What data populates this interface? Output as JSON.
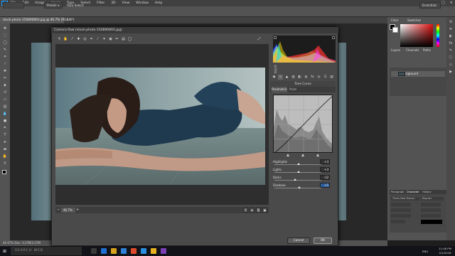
{
  "app": {
    "logo": "Ps"
  },
  "menu": [
    "File",
    "Edit",
    "Image",
    "Layer",
    "Type",
    "Select",
    "Filter",
    "3D",
    "View",
    "Window",
    "Help"
  ],
  "options": {
    "opt1": "Preset: ▾",
    "opt2": "Auto-Select:",
    "workspace": "Essentials"
  },
  "document": {
    "tab": "stock-photo-150890893.jpg @ 46.7% (RGB/8*)",
    "status": "46.67%   Doc: 3.27M/3.27M"
  },
  "dialog": {
    "title": "Camera Raw (stock-photo-150890893.jpg)",
    "zoom": "46.7%",
    "zoom_minus": "−",
    "zoom_plus": "+",
    "panel_title": "Tone Curve",
    "tabs": {
      "parametric": "Parametric",
      "point": "Point"
    },
    "histogram_info": {
      "r": "R:",
      "g": "G:",
      "b": "B:"
    },
    "sliders": [
      {
        "label": "Highlights",
        "value": "+3",
        "pos": 0.52
      },
      {
        "label": "Lights",
        "value": "+3",
        "pos": 0.52
      },
      {
        "label": "Darks",
        "value": "-12",
        "pos": 0.44
      },
      {
        "label": "Shadows",
        "value": "+5",
        "pos": 0.53
      }
    ],
    "buttons": {
      "cancel": "Cancel",
      "ok": "OK"
    }
  },
  "right_panels": {
    "color_tabs": [
      "Color",
      "Swatches"
    ],
    "layer_tabs": [
      "Layers",
      "Channels",
      "Paths"
    ],
    "layer_name": "Background",
    "char_tabs": [
      "Paragraph",
      "Character",
      "History"
    ],
    "char_font": "Times New Roman",
    "char_style": "Regular"
  },
  "taskbar": {
    "start": "⊞",
    "search": "SEARCH WEB",
    "lang": "ENG",
    "time": "11:48 PM",
    "date": "2/1/2016"
  },
  "colors": {
    "accent": "#31a8ff",
    "panel": "#535353",
    "dialog": "#4a4a4a"
  }
}
